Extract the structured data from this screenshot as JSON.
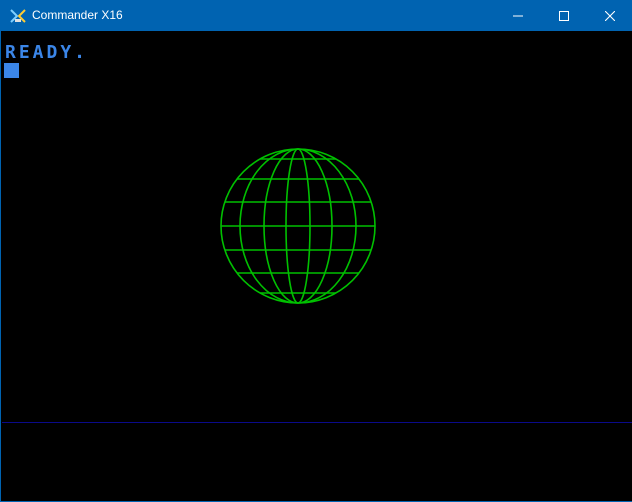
{
  "window": {
    "title": "Commander X16",
    "controls": {
      "minimize": "minimize-icon",
      "maximize": "maximize-icon",
      "close": "close-icon"
    }
  },
  "screen": {
    "prompt": "READY.",
    "text_color": "#3b86e8",
    "globe_color": "#00c000",
    "background": "#000000",
    "divider_color": "#0a0a8a"
  }
}
